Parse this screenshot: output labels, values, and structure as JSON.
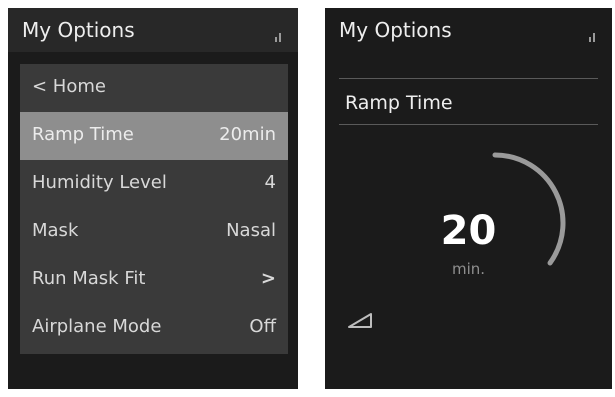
{
  "left_screen": {
    "title": "My Options",
    "signal_icon": "signal-icon",
    "menu": [
      {
        "label": "< Home",
        "value": ""
      },
      {
        "label": "Ramp Time",
        "value": "20min",
        "selected": true
      },
      {
        "label": "Humidity Level",
        "value": "4"
      },
      {
        "label": "Mask",
        "value": "Nasal"
      },
      {
        "label": "Run Mask Fit",
        "value": ">"
      },
      {
        "label": "Airplane Mode",
        "value": "Off"
      }
    ]
  },
  "right_screen": {
    "title": "My Options",
    "signal_icon": "signal-icon",
    "setting_label": "Ramp Time",
    "dial": {
      "value": "20",
      "unit": "min.",
      "level_fraction": 0.35
    },
    "ramp_icon": "ramp-triangle-icon"
  },
  "colors": {
    "screen_bg": "#1b1b1b",
    "menu_bg": "#3a3a3a",
    "selected_bg": "#8e8e8e",
    "dial_arc": "#9a9a9a"
  }
}
